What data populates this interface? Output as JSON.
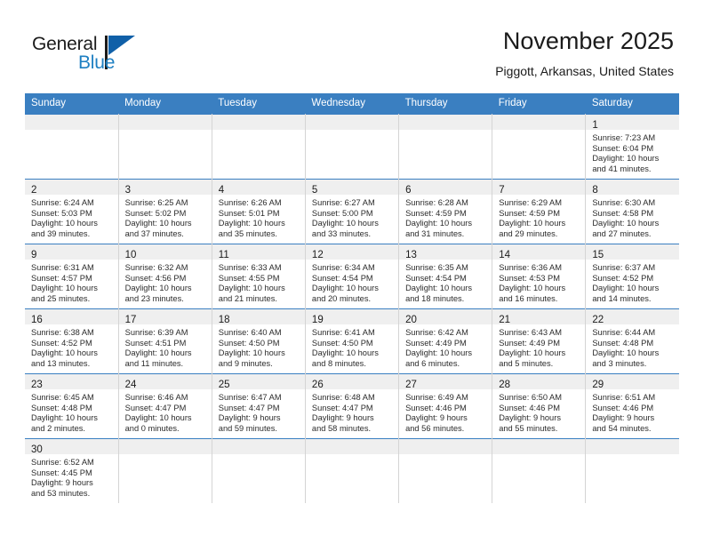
{
  "brand": {
    "name_part1": "General",
    "name_part2": "Blue"
  },
  "header": {
    "title": "November 2025",
    "subtitle": "Piggott, Arkansas, United States"
  },
  "colors": {
    "header_blue": "#3a7fc1",
    "brand_blue": "#1e7fc2",
    "daynum_band": "#efefef",
    "grid_line": "#d4d4d4"
  },
  "weekdays": [
    "Sunday",
    "Monday",
    "Tuesday",
    "Wednesday",
    "Thursday",
    "Friday",
    "Saturday"
  ],
  "weeks": [
    [
      {
        "day": "",
        "lines": []
      },
      {
        "day": "",
        "lines": []
      },
      {
        "day": "",
        "lines": []
      },
      {
        "day": "",
        "lines": []
      },
      {
        "day": "",
        "lines": []
      },
      {
        "day": "",
        "lines": []
      },
      {
        "day": "1",
        "lines": [
          "Sunrise: 7:23 AM",
          "Sunset: 6:04 PM",
          "Daylight: 10 hours",
          "and 41 minutes."
        ]
      }
    ],
    [
      {
        "day": "2",
        "lines": [
          "Sunrise: 6:24 AM",
          "Sunset: 5:03 PM",
          "Daylight: 10 hours",
          "and 39 minutes."
        ]
      },
      {
        "day": "3",
        "lines": [
          "Sunrise: 6:25 AM",
          "Sunset: 5:02 PM",
          "Daylight: 10 hours",
          "and 37 minutes."
        ]
      },
      {
        "day": "4",
        "lines": [
          "Sunrise: 6:26 AM",
          "Sunset: 5:01 PM",
          "Daylight: 10 hours",
          "and 35 minutes."
        ]
      },
      {
        "day": "5",
        "lines": [
          "Sunrise: 6:27 AM",
          "Sunset: 5:00 PM",
          "Daylight: 10 hours",
          "and 33 minutes."
        ]
      },
      {
        "day": "6",
        "lines": [
          "Sunrise: 6:28 AM",
          "Sunset: 4:59 PM",
          "Daylight: 10 hours",
          "and 31 minutes."
        ]
      },
      {
        "day": "7",
        "lines": [
          "Sunrise: 6:29 AM",
          "Sunset: 4:59 PM",
          "Daylight: 10 hours",
          "and 29 minutes."
        ]
      },
      {
        "day": "8",
        "lines": [
          "Sunrise: 6:30 AM",
          "Sunset: 4:58 PM",
          "Daylight: 10 hours",
          "and 27 minutes."
        ]
      }
    ],
    [
      {
        "day": "9",
        "lines": [
          "Sunrise: 6:31 AM",
          "Sunset: 4:57 PM",
          "Daylight: 10 hours",
          "and 25 minutes."
        ]
      },
      {
        "day": "10",
        "lines": [
          "Sunrise: 6:32 AM",
          "Sunset: 4:56 PM",
          "Daylight: 10 hours",
          "and 23 minutes."
        ]
      },
      {
        "day": "11",
        "lines": [
          "Sunrise: 6:33 AM",
          "Sunset: 4:55 PM",
          "Daylight: 10 hours",
          "and 21 minutes."
        ]
      },
      {
        "day": "12",
        "lines": [
          "Sunrise: 6:34 AM",
          "Sunset: 4:54 PM",
          "Daylight: 10 hours",
          "and 20 minutes."
        ]
      },
      {
        "day": "13",
        "lines": [
          "Sunrise: 6:35 AM",
          "Sunset: 4:54 PM",
          "Daylight: 10 hours",
          "and 18 minutes."
        ]
      },
      {
        "day": "14",
        "lines": [
          "Sunrise: 6:36 AM",
          "Sunset: 4:53 PM",
          "Daylight: 10 hours",
          "and 16 minutes."
        ]
      },
      {
        "day": "15",
        "lines": [
          "Sunrise: 6:37 AM",
          "Sunset: 4:52 PM",
          "Daylight: 10 hours",
          "and 14 minutes."
        ]
      }
    ],
    [
      {
        "day": "16",
        "lines": [
          "Sunrise: 6:38 AM",
          "Sunset: 4:52 PM",
          "Daylight: 10 hours",
          "and 13 minutes."
        ]
      },
      {
        "day": "17",
        "lines": [
          "Sunrise: 6:39 AM",
          "Sunset: 4:51 PM",
          "Daylight: 10 hours",
          "and 11 minutes."
        ]
      },
      {
        "day": "18",
        "lines": [
          "Sunrise: 6:40 AM",
          "Sunset: 4:50 PM",
          "Daylight: 10 hours",
          "and 9 minutes."
        ]
      },
      {
        "day": "19",
        "lines": [
          "Sunrise: 6:41 AM",
          "Sunset: 4:50 PM",
          "Daylight: 10 hours",
          "and 8 minutes."
        ]
      },
      {
        "day": "20",
        "lines": [
          "Sunrise: 6:42 AM",
          "Sunset: 4:49 PM",
          "Daylight: 10 hours",
          "and 6 minutes."
        ]
      },
      {
        "day": "21",
        "lines": [
          "Sunrise: 6:43 AM",
          "Sunset: 4:49 PM",
          "Daylight: 10 hours",
          "and 5 minutes."
        ]
      },
      {
        "day": "22",
        "lines": [
          "Sunrise: 6:44 AM",
          "Sunset: 4:48 PM",
          "Daylight: 10 hours",
          "and 3 minutes."
        ]
      }
    ],
    [
      {
        "day": "23",
        "lines": [
          "Sunrise: 6:45 AM",
          "Sunset: 4:48 PM",
          "Daylight: 10 hours",
          "and 2 minutes."
        ]
      },
      {
        "day": "24",
        "lines": [
          "Sunrise: 6:46 AM",
          "Sunset: 4:47 PM",
          "Daylight: 10 hours",
          "and 0 minutes."
        ]
      },
      {
        "day": "25",
        "lines": [
          "Sunrise: 6:47 AM",
          "Sunset: 4:47 PM",
          "Daylight: 9 hours",
          "and 59 minutes."
        ]
      },
      {
        "day": "26",
        "lines": [
          "Sunrise: 6:48 AM",
          "Sunset: 4:47 PM",
          "Daylight: 9 hours",
          "and 58 minutes."
        ]
      },
      {
        "day": "27",
        "lines": [
          "Sunrise: 6:49 AM",
          "Sunset: 4:46 PM",
          "Daylight: 9 hours",
          "and 56 minutes."
        ]
      },
      {
        "day": "28",
        "lines": [
          "Sunrise: 6:50 AM",
          "Sunset: 4:46 PM",
          "Daylight: 9 hours",
          "and 55 minutes."
        ]
      },
      {
        "day": "29",
        "lines": [
          "Sunrise: 6:51 AM",
          "Sunset: 4:46 PM",
          "Daylight: 9 hours",
          "and 54 minutes."
        ]
      }
    ],
    [
      {
        "day": "30",
        "lines": [
          "Sunrise: 6:52 AM",
          "Sunset: 4:45 PM",
          "Daylight: 9 hours",
          "and 53 minutes."
        ]
      },
      {
        "day": "",
        "lines": []
      },
      {
        "day": "",
        "lines": []
      },
      {
        "day": "",
        "lines": []
      },
      {
        "day": "",
        "lines": []
      },
      {
        "day": "",
        "lines": []
      },
      {
        "day": "",
        "lines": []
      }
    ]
  ]
}
